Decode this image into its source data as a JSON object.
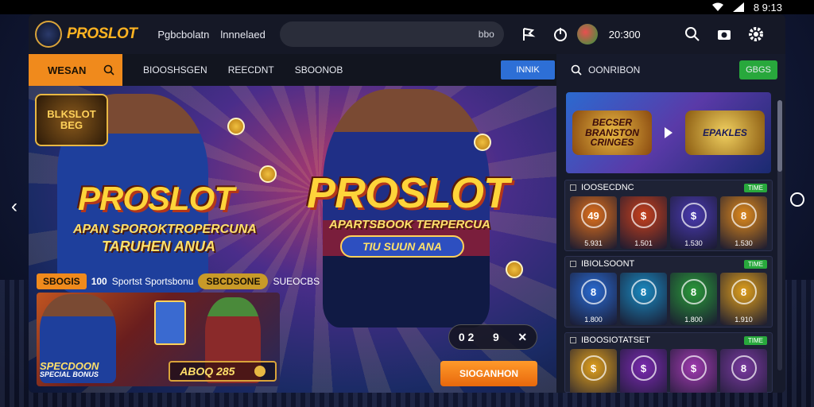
{
  "status_bar": {
    "time": "8 9:13"
  },
  "header": {
    "brand": "PROSLOT",
    "links": [
      "Pgbcbolatn",
      "lnnnelaed"
    ],
    "search_value": "bbo",
    "balance": "20:300"
  },
  "nav": {
    "primary": "WESAN",
    "items": [
      "BIOOSHSGEN",
      "REECDNT",
      "SBOONOB"
    ],
    "button": "INNIK"
  },
  "hero": {
    "badge_line1": "BLKSLOT",
    "badge_line2": "BEG",
    "title_left": "PROSLOT",
    "subtitle_left_1": "APAN SPOROKTROPERCUNA",
    "subtitle_left_2": "TARUHEN ANUA",
    "title_center": "PROSLOT",
    "subtitle_center": "APARTSBOOK TERPERCUA",
    "pill": "TIU SUUN ANA",
    "strip_tag": "SBOGIS",
    "strip_num": "100",
    "strip_text": "Sportst Sportsbonu",
    "strip_gold": "SBCDSONE",
    "strip_end": "SUEOCBS",
    "card_title": "SPECDOON",
    "card_sub": "SPECIAL BONUS",
    "card_code": "ABOQ 285",
    "ctrl_left": "0 2",
    "ctrl_mid": "9",
    "cta": "SIOGANHON"
  },
  "right_panel": {
    "search_label": "OONRIBON",
    "go_button": "GBGS",
    "promo_left": "BECSER BRANSTON CRINGES",
    "promo_right": "EPAKLES",
    "sections": [
      {
        "title": "IOOSECDNC",
        "badge": "TIME",
        "tiles": [
          {
            "label": "5.931",
            "symbol": "49",
            "color": "#e0701c"
          },
          {
            "label": "1.501",
            "symbol": "$",
            "color": "#c8401c"
          },
          {
            "label": "1.530",
            "symbol": "$",
            "color": "#4a3ab0"
          },
          {
            "label": "1.530",
            "symbol": "8",
            "color": "#e08a1c"
          }
        ]
      },
      {
        "title": "IBIOLSOONT",
        "badge": "TIME",
        "tiles": [
          {
            "label": "1.800",
            "symbol": "8",
            "color": "#2a6ad0"
          },
          {
            "label": "",
            "symbol": "8",
            "color": "#1a8ac0"
          },
          {
            "label": "1.800",
            "symbol": "8",
            "color": "#2a9a3a"
          },
          {
            "label": "1.910",
            "symbol": "8",
            "color": "#e0a01c"
          }
        ]
      },
      {
        "title": "IBOOSIOTATSET",
        "badge": "TIME",
        "tiles": [
          {
            "label": "",
            "symbol": "$",
            "color": "#e0a01c"
          },
          {
            "label": "",
            "symbol": "$",
            "color": "#7a2ab0"
          },
          {
            "label": "",
            "symbol": "$",
            "color": "#a03ab0"
          },
          {
            "label": "",
            "symbol": "8",
            "color": "#7a3aa0"
          }
        ]
      }
    ]
  }
}
